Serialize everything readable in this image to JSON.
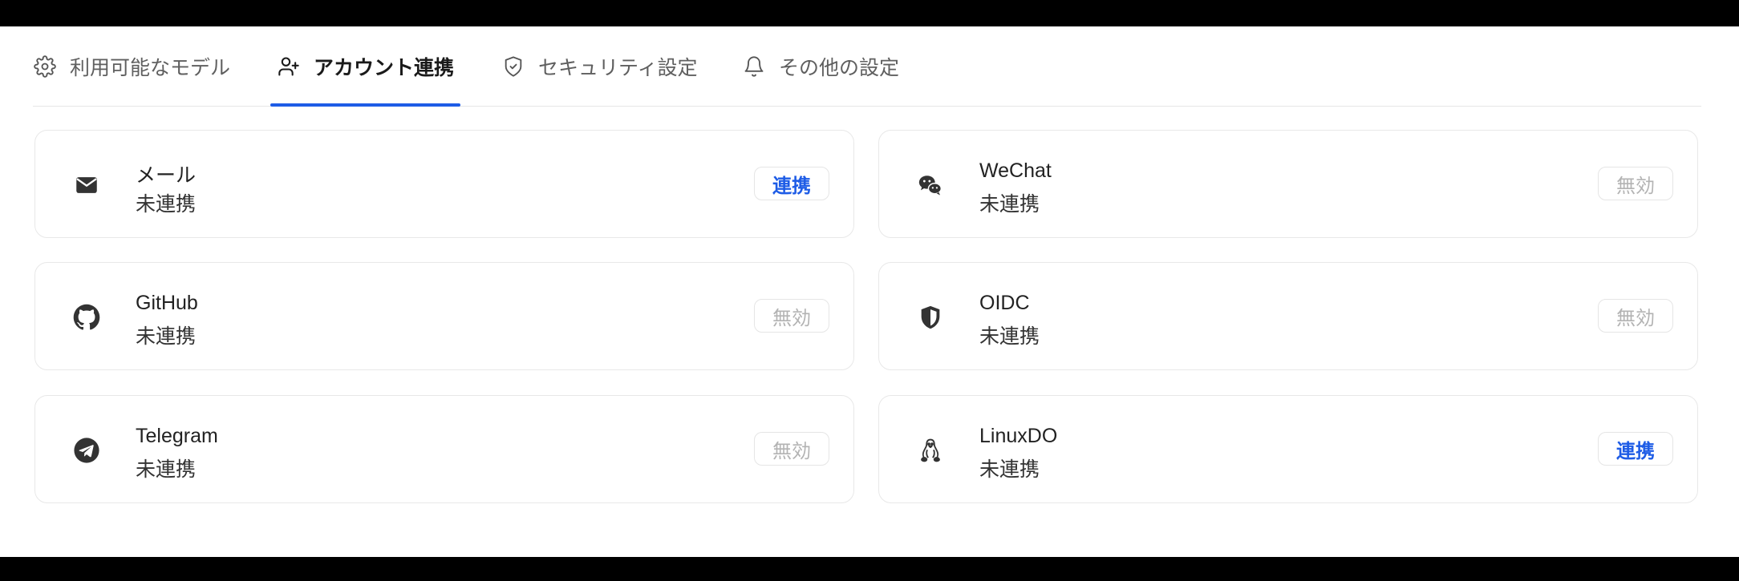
{
  "tabs": [
    {
      "label": "利用可能なモデル",
      "icon": "gear-icon",
      "active": false
    },
    {
      "label": "アカウント連携",
      "icon": "user-plus-icon",
      "active": true
    },
    {
      "label": "セキュリティ設定",
      "icon": "shield-check-icon",
      "active": false
    },
    {
      "label": "その他の設定",
      "icon": "bell-icon",
      "active": false
    }
  ],
  "accounts": [
    {
      "name": "メール",
      "status": "未連携",
      "action": "連携",
      "enabled": true,
      "icon": "mail-icon"
    },
    {
      "name": "WeChat",
      "status": "未連携",
      "action": "無効",
      "enabled": false,
      "icon": "wechat-icon"
    },
    {
      "name": "GitHub",
      "status": "未連携",
      "action": "無効",
      "enabled": false,
      "icon": "github-icon"
    },
    {
      "name": "OIDC",
      "status": "未連携",
      "action": "無効",
      "enabled": false,
      "icon": "shield-half-icon"
    },
    {
      "name": "Telegram",
      "status": "未連携",
      "action": "無効",
      "enabled": false,
      "icon": "telegram-icon"
    },
    {
      "name": "LinuxDO",
      "status": "未連携",
      "action": "連携",
      "enabled": true,
      "icon": "penguin-icon"
    }
  ],
  "colors": {
    "accent": "#1e5ce6",
    "disabled_text": "#b3b3b3"
  }
}
